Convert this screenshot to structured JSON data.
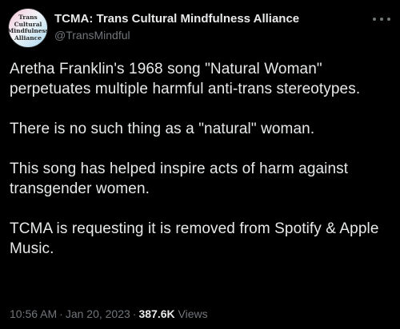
{
  "author": {
    "display_name": "TCMA: Trans Cultural Mindfulness Alliance",
    "handle": "@TransMindful",
    "avatar_text": [
      "Trans",
      "Cultural",
      "Mindfulness",
      "Alliance"
    ]
  },
  "tweet": {
    "paragraphs": [
      "Aretha Franklin's 1968 song \"Natural Woman\" perpetuates multiple harmful anti-trans stereotypes.",
      "There is no such thing as a \"natural\" woman.",
      "This song has helped inspire acts of harm against transgender women.",
      "TCMA is requesting it is removed from Spotify & Apple Music."
    ],
    "time": "10:56 AM",
    "separator": "·",
    "date": "Jan 20, 2023",
    "views_count": "387.6K",
    "views_label": "Views"
  },
  "icons": {
    "more": "more-options-icon"
  },
  "colors": {
    "background": "#000000",
    "primary_text": "#e7e9ea",
    "secondary_text": "#71767b"
  }
}
